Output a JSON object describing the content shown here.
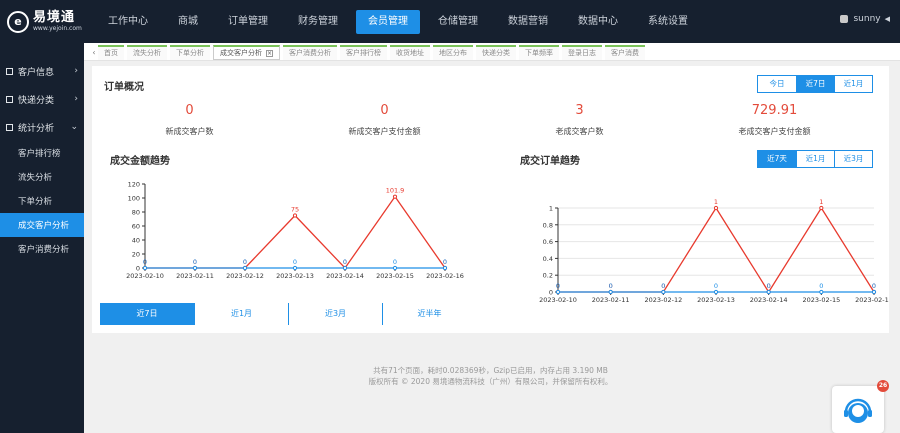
{
  "brand": {
    "name": "易境通",
    "url": "www.yejoin.com",
    "logo_glyph": "e"
  },
  "topnav": [
    {
      "label": "工作中心"
    },
    {
      "label": "商城"
    },
    {
      "label": "订单管理"
    },
    {
      "label": "财务管理"
    },
    {
      "label": "会员管理",
      "active": true
    },
    {
      "label": "仓储管理"
    },
    {
      "label": "数据营销"
    },
    {
      "label": "数据中心"
    },
    {
      "label": "系统设置"
    }
  ],
  "user": {
    "name": "sunny"
  },
  "sidebar": {
    "groups": [
      {
        "label": "客户信息",
        "expanded": false
      },
      {
        "label": "快递分类",
        "expanded": false
      },
      {
        "label": "统计分析",
        "expanded": true
      }
    ],
    "sub_items": [
      {
        "label": "客户排行榜"
      },
      {
        "label": "流失分析"
      },
      {
        "label": "下单分析"
      },
      {
        "label": "成交客户分析",
        "active": true
      },
      {
        "label": "客户消费分析"
      }
    ]
  },
  "tabs": [
    {
      "label": "首页"
    },
    {
      "label": "流失分析"
    },
    {
      "label": "下单分析"
    },
    {
      "label": "成交客户分析",
      "active": true
    },
    {
      "label": "客户消费分析"
    },
    {
      "label": "客户排行榜"
    },
    {
      "label": "收货地址"
    },
    {
      "label": "地区分布"
    },
    {
      "label": "快递分类"
    },
    {
      "label": "下单频率"
    },
    {
      "label": "登录日志"
    },
    {
      "label": "客户消费"
    }
  ],
  "overview": {
    "title": "订单概况",
    "ranges": [
      {
        "label": "今日"
      },
      {
        "label": "近7日",
        "active": true
      },
      {
        "label": "近1月"
      }
    ],
    "stats": [
      {
        "value": "0",
        "label": "新成交客户数"
      },
      {
        "value": "0",
        "label": "新成交客户支付金额"
      },
      {
        "value": "3",
        "label": "老成交客户数"
      },
      {
        "value": "729.91",
        "label": "老成交客户支付金额"
      }
    ]
  },
  "amount_trend": {
    "title": "成交金额趋势"
  },
  "order_trend": {
    "title": "成交订单趋势",
    "ranges": [
      {
        "label": "近7天",
        "active": true
      },
      {
        "label": "近1月"
      },
      {
        "label": "近3月"
      }
    ]
  },
  "bottom_tabs": [
    {
      "label": "近7日",
      "active": true
    },
    {
      "label": "近1月"
    },
    {
      "label": "近3月"
    },
    {
      "label": "近半年"
    }
  ],
  "footer": {
    "line1": "共有71个页面，耗时0.028369秒，Gzip已启用，内存占用 3.190 MB",
    "line2": "版权所有 © 2020 易境通物流科技（广州）有限公司，并保留所有权利。"
  },
  "chat": {
    "badge": "26"
  },
  "colors": {
    "accent": "#1e8fe6",
    "sidebar": "#16202f",
    "red_series": "#e83a2e",
    "blue_series": "#1e8fe6"
  },
  "chart_data": [
    {
      "type": "line",
      "title": "成交金额趋势",
      "x": [
        "2023-02-10",
        "2023-02-11",
        "2023-02-12",
        "2023-02-13",
        "2023-02-14",
        "2023-02-15",
        "2023-02-16"
      ],
      "ylim": [
        0,
        120
      ],
      "yticks": [
        0,
        20,
        40,
        60,
        80,
        100,
        120
      ],
      "series": [
        {
          "color": "#e83a2e",
          "values": [
            0,
            0,
            0,
            75,
            0,
            101.9,
            0
          ],
          "labels": [
            "0",
            "0",
            "0",
            "75",
            "0",
            "101.9",
            "0"
          ]
        },
        {
          "color": "#1e8fe6",
          "values": [
            0,
            0,
            0,
            0,
            0,
            0,
            0
          ],
          "labels": [
            "0",
            "0",
            "0",
            "0",
            "0",
            "0",
            "0"
          ]
        }
      ],
      "grid": false
    },
    {
      "type": "line",
      "title": "成交订单趋势",
      "x": [
        "2023-02-10",
        "2023-02-11",
        "2023-02-12",
        "2023-02-13",
        "2023-02-14",
        "2023-02-15",
        "2023-02-16"
      ],
      "ylim": [
        0,
        1
      ],
      "yticks": [
        0,
        0.2,
        0.4,
        0.6,
        0.8,
        1
      ],
      "series": [
        {
          "color": "#e83a2e",
          "values": [
            0,
            0,
            0,
            1,
            0,
            1,
            0
          ],
          "labels": [
            "0",
            "0",
            "0",
            "1",
            "0",
            "1",
            "0"
          ]
        },
        {
          "color": "#1e8fe6",
          "values": [
            0,
            0,
            0,
            0,
            0,
            0,
            0
          ],
          "labels": [
            "0",
            "0",
            "0",
            "0",
            "0",
            "0",
            "0"
          ]
        }
      ],
      "grid": true
    }
  ]
}
